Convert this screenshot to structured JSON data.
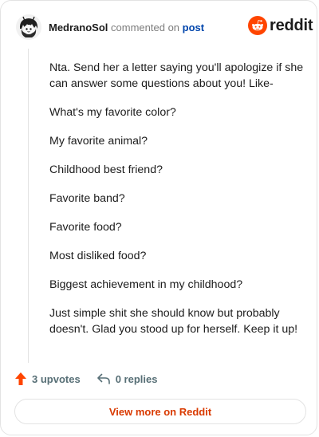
{
  "header": {
    "username": "MedranoSol",
    "action_text": "commented on",
    "post_link": "post",
    "brand": "reddit",
    "brand_icon": "reddit-snoo-icon",
    "avatar_icon": "user-avatar"
  },
  "comment": {
    "paragraphs": [
      "Nta. Send her a letter saying you'll apologize if she can answer some questions about you! Like-",
      "What's my favorite color?",
      "My favorite animal?",
      "Childhood best friend?",
      "Favorite band?",
      "Favorite food?",
      "Most disliked food?",
      "Biggest achievement in my childhood?",
      "Just simple shit she should know but probably doesn't. Glad you stood up for herself. Keep it up!"
    ]
  },
  "actions": {
    "upvotes_label": "3 upvotes",
    "replies_label": "0 replies",
    "upvote_icon": "upvote-arrow-icon",
    "reply_icon": "reply-arrow-icon"
  },
  "footer": {
    "view_more_label": "View more on Reddit"
  },
  "colors": {
    "brand_orange": "#ff4500",
    "link_blue": "#0045ac",
    "view_more_text": "#d93a00",
    "muted_text": "#576f76",
    "border": "#e3e3e3"
  }
}
